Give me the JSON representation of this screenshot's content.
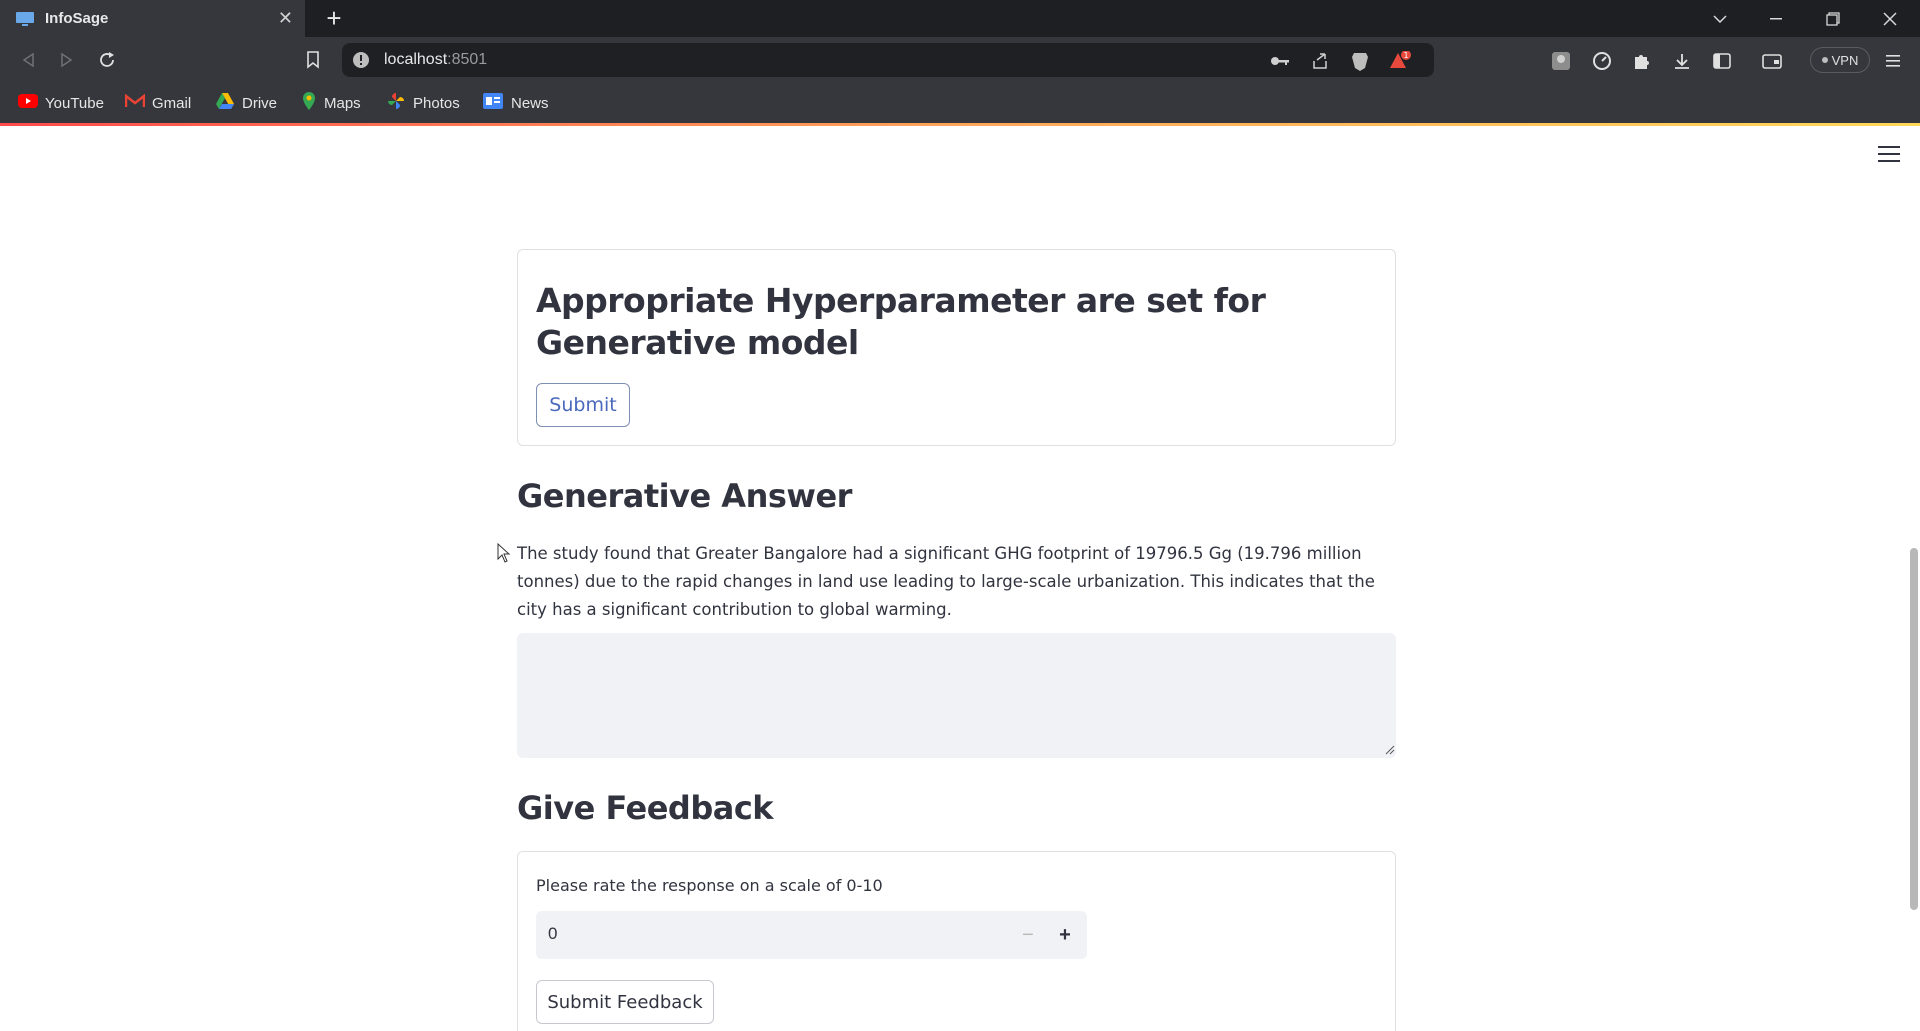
{
  "browser": {
    "tab_title": "InfoSage",
    "url_host": "localhost",
    "url_port": ":8501",
    "vpn_label": "VPN",
    "notification_count": "1",
    "bookmarks": [
      {
        "label": "YouTube",
        "icon": "youtube-icon"
      },
      {
        "label": "Gmail",
        "icon": "gmail-icon"
      },
      {
        "label": "Drive",
        "icon": "drive-icon"
      },
      {
        "label": "Maps",
        "icon": "maps-icon"
      },
      {
        "label": "Photos",
        "icon": "photos-icon"
      },
      {
        "label": "News",
        "icon": "news-icon"
      }
    ]
  },
  "hyperparam_card": {
    "title": "Appropriate Hyperparameter are set for Generative model",
    "submit_label": "Submit"
  },
  "answer_section": {
    "heading": "Generative Answer",
    "text": "The study found that Greater Bangalore had a significant GHG footprint of 19796.5 Gg (19.796 million tonnes) due to the rapid changes in land use leading to large-scale urbanization. This indicates that the city has a significant contribution to global warming.",
    "textarea_value": ""
  },
  "feedback": {
    "heading": "Give Feedback",
    "rating_label": "Please rate the response on a scale of 0-10",
    "rating_value": "0",
    "minus_symbol": "−",
    "plus_symbol": "+",
    "submit_label": "Submit Feedback"
  },
  "colors": {
    "accent_link": "#4a69bd",
    "text": "#31333f",
    "input_bg": "#f0f2f6"
  }
}
